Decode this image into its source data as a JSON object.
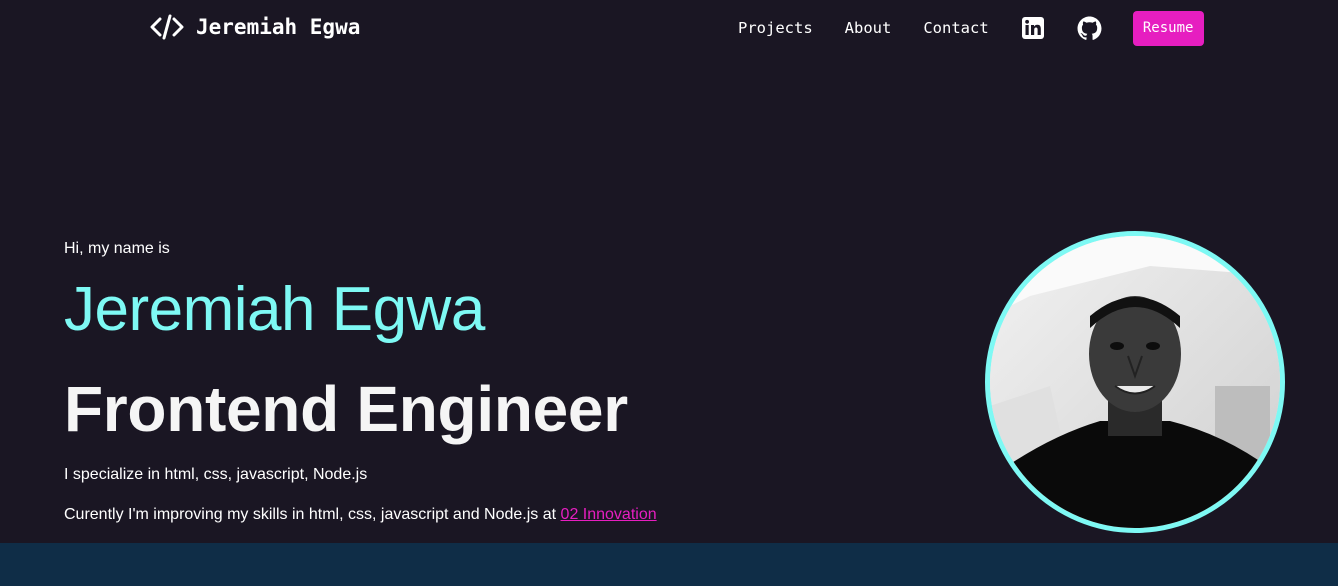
{
  "brand": {
    "icon": "code-icon",
    "name": "Jeremiah Egwa"
  },
  "nav": {
    "projects": "Projects",
    "about": "About",
    "contact": "Contact",
    "linkedin_icon": "linkedin-icon",
    "github_icon": "github-icon",
    "resume": "Resume"
  },
  "hero": {
    "greeting": "Hi, my name is",
    "name": "Jeremiah Egwa",
    "role": "Frontend Engineer",
    "skills": "I specialize in html, css, javascript, Node.js",
    "current_prefix": "Curently I'm improving my skills in html, css, javascript and Node.js at ",
    "current_link": "02 Innovation"
  },
  "colors": {
    "background": "#1a1623",
    "accent_cyan": "#7ef9f4",
    "accent_pink": "#e61ec0",
    "band": "#0f2d47"
  }
}
